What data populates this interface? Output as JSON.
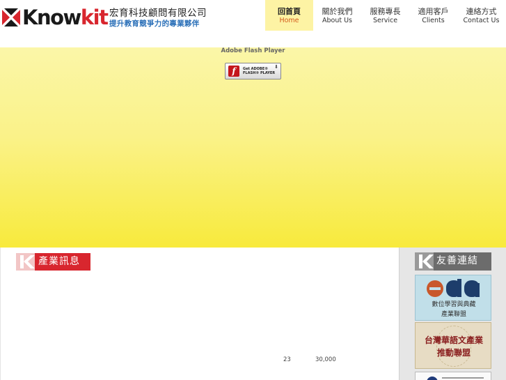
{
  "header": {
    "logo_text_1": "Know",
    "logo_text_2": "kit",
    "company_name": "宏育科技顧問有限公司",
    "tagline": "提升教育競爭力的專業夥伴"
  },
  "nav": {
    "items": [
      {
        "zh": "回首頁",
        "en": "Home",
        "active": true
      },
      {
        "zh": "關於我們",
        "en": "About Us",
        "active": false
      },
      {
        "zh": "服務專長",
        "en": "Service",
        "active": false
      },
      {
        "zh": "適用客戶",
        "en": "Clients",
        "active": false
      },
      {
        "zh": "連絡方式",
        "en": "Contact Us",
        "active": false
      }
    ]
  },
  "banner": {
    "flash_title": "Adobe Flash Player",
    "flash_button": {
      "line1": "Get ADOBE®",
      "line2": "FLASH® PLAYER",
      "logo": "f"
    }
  },
  "content": {
    "section_title": "產業訊息",
    "stats": [
      "23",
      "30,000"
    ]
  },
  "sidebar": {
    "title": "友善連結",
    "links": [
      {
        "name": "eda",
        "logo_text": "eda",
        "line1": "數位學習與典藏",
        "line2": "產業聯盟"
      },
      {
        "name": "chinese-alliance",
        "line1": "台灣華語文產業",
        "line2": "推動聯盟"
      }
    ]
  },
  "colors": {
    "brand_red": "#d8262e",
    "nav_active_bg": "#fdf3a4",
    "banner_yellow": "#f8ea3c",
    "tagline_blue": "#2a6fb8"
  }
}
